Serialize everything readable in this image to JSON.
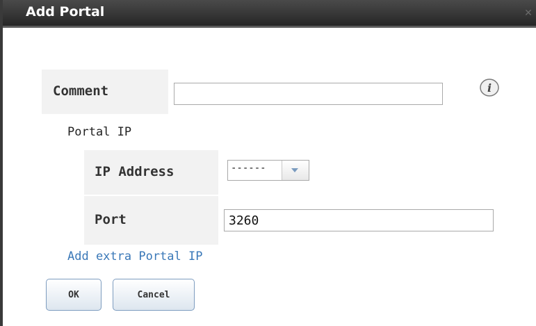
{
  "dialog": {
    "title": "Add Portal",
    "close_icon": "close-icon"
  },
  "comment": {
    "label": "Comment",
    "value": "",
    "info_icon": "info-icon"
  },
  "portal_ip": {
    "section_label": "Portal IP",
    "ip_address": {
      "label": "IP Address",
      "selected": "------"
    },
    "port": {
      "label": "Port",
      "value": "3260"
    }
  },
  "add_extra_link": "Add extra Portal IP",
  "buttons": {
    "ok": "OK",
    "cancel": "Cancel"
  },
  "colors": {
    "titlebar": "#2e2e2e",
    "link": "#3a78b8",
    "label_bg": "#f2f2f2"
  }
}
